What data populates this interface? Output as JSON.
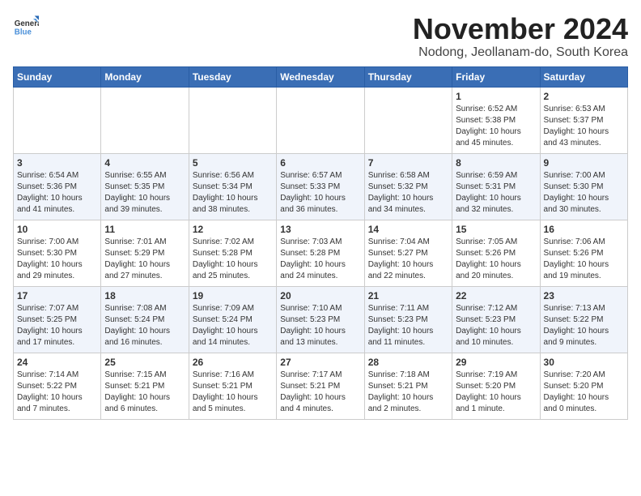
{
  "header": {
    "logo_line1": "General",
    "logo_line2": "Blue",
    "month": "November 2024",
    "location": "Nodong, Jeollanam-do, South Korea"
  },
  "weekdays": [
    "Sunday",
    "Monday",
    "Tuesday",
    "Wednesday",
    "Thursday",
    "Friday",
    "Saturday"
  ],
  "weeks": [
    [
      {
        "day": "",
        "info": ""
      },
      {
        "day": "",
        "info": ""
      },
      {
        "day": "",
        "info": ""
      },
      {
        "day": "",
        "info": ""
      },
      {
        "day": "",
        "info": ""
      },
      {
        "day": "1",
        "info": "Sunrise: 6:52 AM\nSunset: 5:38 PM\nDaylight: 10 hours\nand 45 minutes."
      },
      {
        "day": "2",
        "info": "Sunrise: 6:53 AM\nSunset: 5:37 PM\nDaylight: 10 hours\nand 43 minutes."
      }
    ],
    [
      {
        "day": "3",
        "info": "Sunrise: 6:54 AM\nSunset: 5:36 PM\nDaylight: 10 hours\nand 41 minutes."
      },
      {
        "day": "4",
        "info": "Sunrise: 6:55 AM\nSunset: 5:35 PM\nDaylight: 10 hours\nand 39 minutes."
      },
      {
        "day": "5",
        "info": "Sunrise: 6:56 AM\nSunset: 5:34 PM\nDaylight: 10 hours\nand 38 minutes."
      },
      {
        "day": "6",
        "info": "Sunrise: 6:57 AM\nSunset: 5:33 PM\nDaylight: 10 hours\nand 36 minutes."
      },
      {
        "day": "7",
        "info": "Sunrise: 6:58 AM\nSunset: 5:32 PM\nDaylight: 10 hours\nand 34 minutes."
      },
      {
        "day": "8",
        "info": "Sunrise: 6:59 AM\nSunset: 5:31 PM\nDaylight: 10 hours\nand 32 minutes."
      },
      {
        "day": "9",
        "info": "Sunrise: 7:00 AM\nSunset: 5:30 PM\nDaylight: 10 hours\nand 30 minutes."
      }
    ],
    [
      {
        "day": "10",
        "info": "Sunrise: 7:00 AM\nSunset: 5:30 PM\nDaylight: 10 hours\nand 29 minutes."
      },
      {
        "day": "11",
        "info": "Sunrise: 7:01 AM\nSunset: 5:29 PM\nDaylight: 10 hours\nand 27 minutes."
      },
      {
        "day": "12",
        "info": "Sunrise: 7:02 AM\nSunset: 5:28 PM\nDaylight: 10 hours\nand 25 minutes."
      },
      {
        "day": "13",
        "info": "Sunrise: 7:03 AM\nSunset: 5:28 PM\nDaylight: 10 hours\nand 24 minutes."
      },
      {
        "day": "14",
        "info": "Sunrise: 7:04 AM\nSunset: 5:27 PM\nDaylight: 10 hours\nand 22 minutes."
      },
      {
        "day": "15",
        "info": "Sunrise: 7:05 AM\nSunset: 5:26 PM\nDaylight: 10 hours\nand 20 minutes."
      },
      {
        "day": "16",
        "info": "Sunrise: 7:06 AM\nSunset: 5:26 PM\nDaylight: 10 hours\nand 19 minutes."
      }
    ],
    [
      {
        "day": "17",
        "info": "Sunrise: 7:07 AM\nSunset: 5:25 PM\nDaylight: 10 hours\nand 17 minutes."
      },
      {
        "day": "18",
        "info": "Sunrise: 7:08 AM\nSunset: 5:24 PM\nDaylight: 10 hours\nand 16 minutes."
      },
      {
        "day": "19",
        "info": "Sunrise: 7:09 AM\nSunset: 5:24 PM\nDaylight: 10 hours\nand 14 minutes."
      },
      {
        "day": "20",
        "info": "Sunrise: 7:10 AM\nSunset: 5:23 PM\nDaylight: 10 hours\nand 13 minutes."
      },
      {
        "day": "21",
        "info": "Sunrise: 7:11 AM\nSunset: 5:23 PM\nDaylight: 10 hours\nand 11 minutes."
      },
      {
        "day": "22",
        "info": "Sunrise: 7:12 AM\nSunset: 5:23 PM\nDaylight: 10 hours\nand 10 minutes."
      },
      {
        "day": "23",
        "info": "Sunrise: 7:13 AM\nSunset: 5:22 PM\nDaylight: 10 hours\nand 9 minutes."
      }
    ],
    [
      {
        "day": "24",
        "info": "Sunrise: 7:14 AM\nSunset: 5:22 PM\nDaylight: 10 hours\nand 7 minutes."
      },
      {
        "day": "25",
        "info": "Sunrise: 7:15 AM\nSunset: 5:21 PM\nDaylight: 10 hours\nand 6 minutes."
      },
      {
        "day": "26",
        "info": "Sunrise: 7:16 AM\nSunset: 5:21 PM\nDaylight: 10 hours\nand 5 minutes."
      },
      {
        "day": "27",
        "info": "Sunrise: 7:17 AM\nSunset: 5:21 PM\nDaylight: 10 hours\nand 4 minutes."
      },
      {
        "day": "28",
        "info": "Sunrise: 7:18 AM\nSunset: 5:21 PM\nDaylight: 10 hours\nand 2 minutes."
      },
      {
        "day": "29",
        "info": "Sunrise: 7:19 AM\nSunset: 5:20 PM\nDaylight: 10 hours\nand 1 minute."
      },
      {
        "day": "30",
        "info": "Sunrise: 7:20 AM\nSunset: 5:20 PM\nDaylight: 10 hours\nand 0 minutes."
      }
    ]
  ]
}
